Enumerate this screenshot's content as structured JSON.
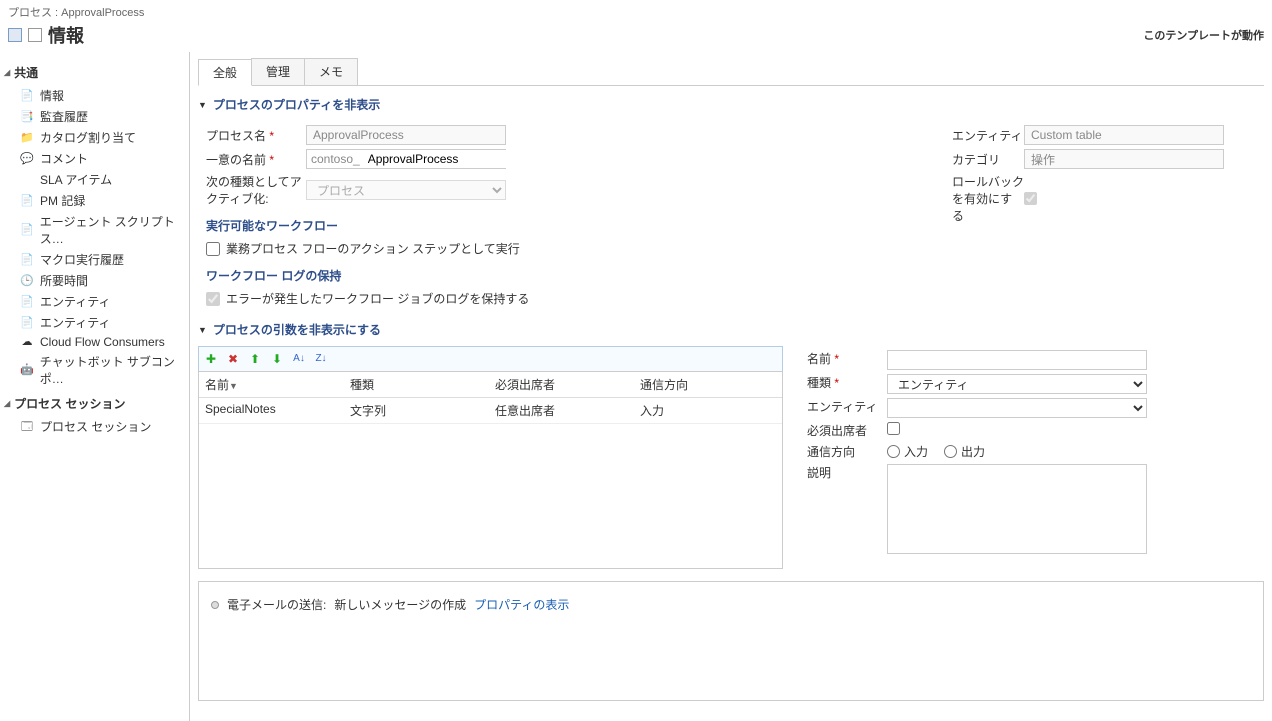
{
  "header": {
    "breadcrumb": "プロセス : ApprovalProcess",
    "title": "情報",
    "top_right": "このテンプレートが動作"
  },
  "sidebar": {
    "group1_title": "共通",
    "items1": [
      {
        "label": "情報",
        "icon": "📄"
      },
      {
        "label": "監査履歴",
        "icon": "📑"
      },
      {
        "label": "カタログ割り当て",
        "icon": "📁"
      },
      {
        "label": "コメント",
        "icon": "💬"
      },
      {
        "label": "SLA アイテム",
        "icon": ""
      },
      {
        "label": "PM 記録",
        "icon": "📄"
      },
      {
        "label": "エージェント スクリプト ス…",
        "icon": "📄"
      },
      {
        "label": "マクロ実行履歴",
        "icon": "📄"
      },
      {
        "label": "所要時間",
        "icon": "🕒"
      },
      {
        "label": "エンティティ",
        "icon": "📄"
      },
      {
        "label": "エンティティ",
        "icon": "📄"
      },
      {
        "label": "Cloud Flow Consumers",
        "icon": "☁"
      },
      {
        "label": "チャットボット サブコンポ…",
        "icon": "🤖"
      }
    ],
    "group2_title": "プロセス セッション",
    "items2": [
      {
        "label": "プロセス セッション",
        "icon": "🗔"
      }
    ]
  },
  "tabs": [
    {
      "label": "全般",
      "active": true
    },
    {
      "label": "管理",
      "active": false
    },
    {
      "label": "メモ",
      "active": false
    }
  ],
  "section_props": "プロセスのプロパティを非表示",
  "props": {
    "name_label": "プロセス名",
    "name_value": "ApprovalProcess",
    "unique_label": "一意の名前",
    "unique_prefix": "contoso_",
    "unique_value": "ApprovalProcess",
    "activate_label": "次の種類としてアクティブ化:",
    "activate_value": "プロセス",
    "entity_label": "エンティティ",
    "entity_value": "Custom table",
    "category_label": "カテゴリ",
    "category_value": "操作",
    "rollback_label": "ロールバックを有効にする"
  },
  "workflow_exec": {
    "header": "実行可能なワークフロー",
    "opt1": "業務プロセス フローのアクション ステップとして実行"
  },
  "workflow_log": {
    "header": "ワークフロー ログの保持",
    "opt1": "エラーが発生したワークフロー ジョブのログを保持する"
  },
  "section_args": "プロセスの引数を非表示にする",
  "args_grid": {
    "cols": [
      "名前",
      "種類",
      "必須出席者",
      "通信方向"
    ],
    "rows": [
      {
        "name": "SpecialNotes",
        "type": "文字列",
        "required": "任意出席者",
        "direction": "入力"
      }
    ]
  },
  "arg_detail": {
    "name_label": "名前",
    "type_label": "種類",
    "type_value": "エンティティ",
    "entity_label": "エンティティ",
    "required_label": "必須出席者",
    "direction_label": "通信方向",
    "dir_in": "入力",
    "dir_out": "出力",
    "desc_label": "説明"
  },
  "steps": {
    "item1_prefix": "電子メールの送信:",
    "item1_text": "新しいメッセージの作成",
    "item1_link": "プロパティの表示"
  }
}
